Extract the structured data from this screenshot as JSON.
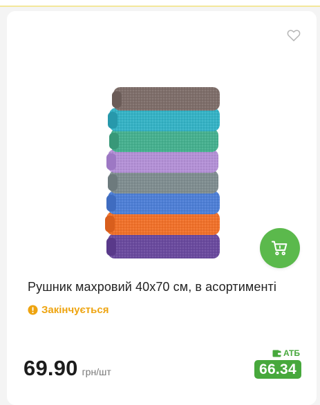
{
  "product": {
    "title": "Рушник махровий 40х70 см, в асортименті",
    "status": "Закінчується",
    "price": "69.90",
    "unit": "грн/шт",
    "club_label": "АТБ",
    "club_price": "66.34"
  },
  "icons": {
    "favorite": "heart-outline-icon",
    "cart": "shopping-cart-icon",
    "status": "exclamation-circle-icon",
    "club": "wallet-icon"
  },
  "colors": {
    "accent_green": "#47a83c",
    "cart_button": "#5bb94c",
    "status_orange": "#eea410",
    "top_line": "#f3e79a"
  }
}
